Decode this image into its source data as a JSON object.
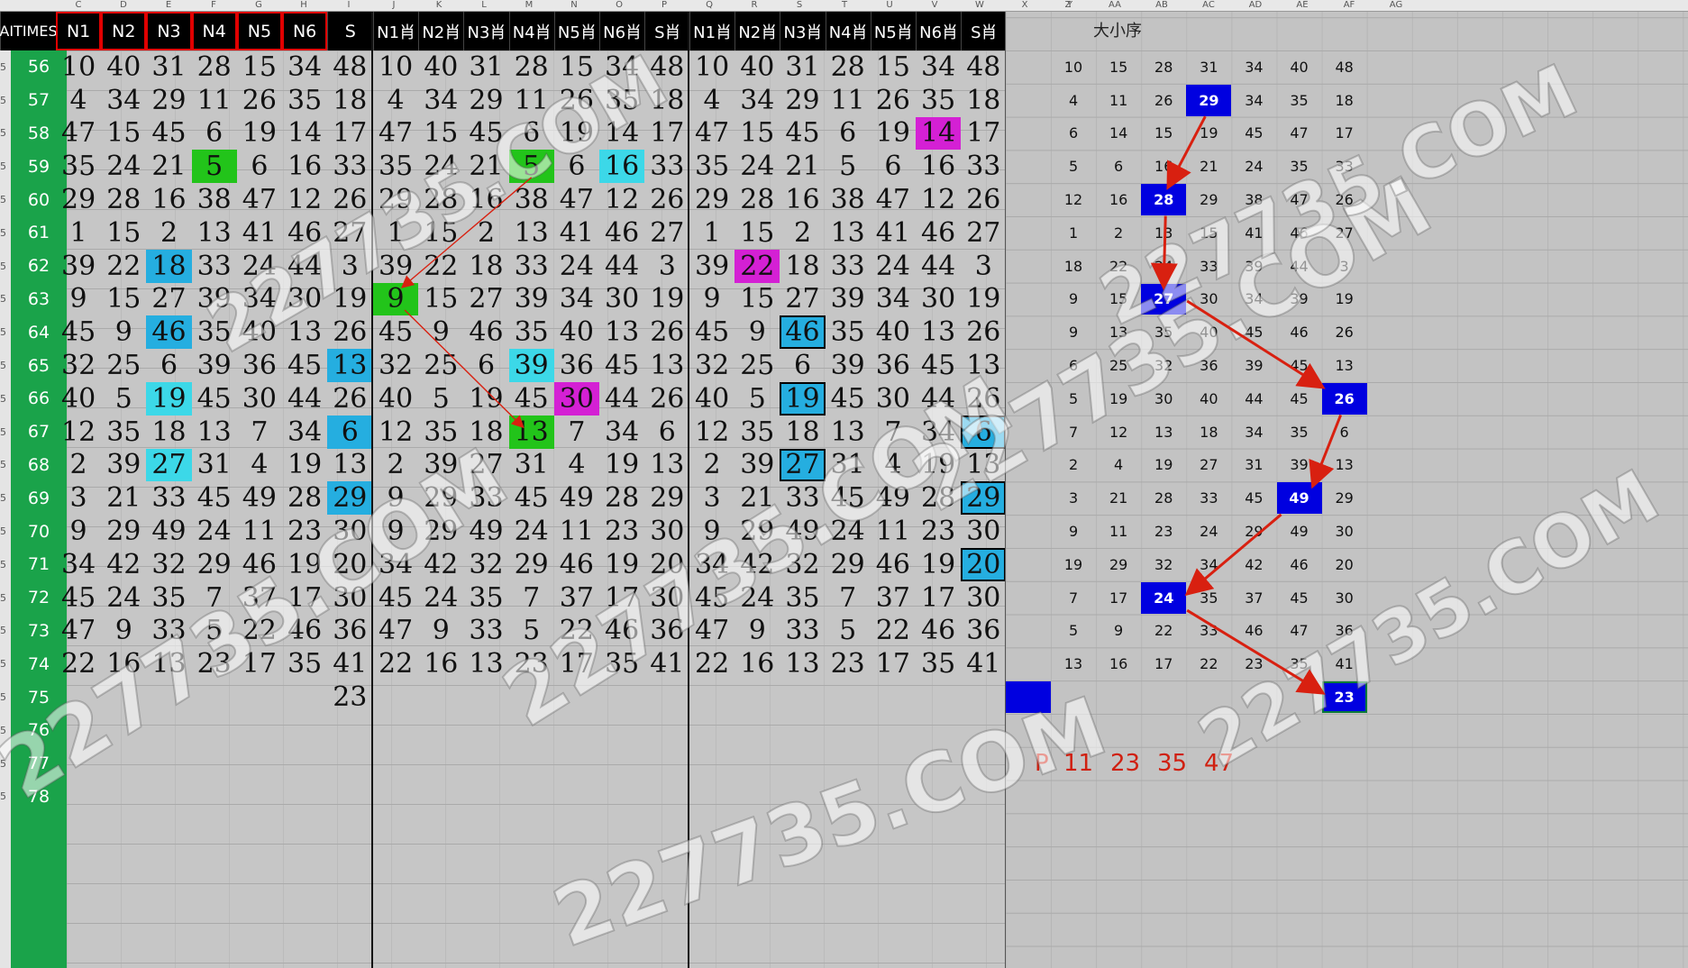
{
  "column_letters": [
    "C",
    "D",
    "E",
    "F",
    "G",
    "H",
    "I",
    "J",
    "K",
    "L",
    "M",
    "N",
    "O",
    "P",
    "Q",
    "R",
    "S",
    "T",
    "U",
    "V",
    "W",
    "X",
    "Y",
    "Z",
    "AA",
    "AB",
    "AC",
    "AD",
    "AE",
    "AF",
    "AG"
  ],
  "headers": {
    "times": "AITIMES",
    "group1": [
      "N1",
      "N2",
      "N3",
      "N4",
      "N5",
      "N6",
      "S"
    ],
    "group2": [
      "N1肖",
      "N2肖",
      "N3肖",
      "N4肖",
      "N5肖",
      "N6肖",
      "S肖"
    ],
    "group3": [
      "N1肖",
      "N2肖",
      "N3肖",
      "N4肖",
      "N5肖",
      "N6肖",
      "S肖"
    ]
  },
  "row_labels": [
    "56",
    "57",
    "58",
    "59",
    "60",
    "61",
    "62",
    "63",
    "64",
    "65",
    "66",
    "67",
    "68",
    "69",
    "70",
    "71",
    "72",
    "73",
    "74",
    "75",
    "76",
    "77",
    "78"
  ],
  "group1_rows": [
    [
      "10",
      "40",
      "31",
      "28",
      "15",
      "34",
      "48"
    ],
    [
      "4",
      "34",
      "29",
      "11",
      "26",
      "35",
      "18"
    ],
    [
      "47",
      "15",
      "45",
      "6",
      "19",
      "14",
      "17"
    ],
    [
      "35",
      "24",
      "21",
      "5",
      "6",
      "16",
      "33"
    ],
    [
      "29",
      "28",
      "16",
      "38",
      "47",
      "12",
      "26"
    ],
    [
      "1",
      "15",
      "2",
      "13",
      "41",
      "46",
      "27"
    ],
    [
      "39",
      "22",
      "18",
      "33",
      "24",
      "44",
      "3"
    ],
    [
      "9",
      "15",
      "27",
      "39",
      "34",
      "30",
      "19"
    ],
    [
      "45",
      "9",
      "46",
      "35",
      "40",
      "13",
      "26"
    ],
    [
      "32",
      "25",
      "6",
      "39",
      "36",
      "45",
      "13"
    ],
    [
      "40",
      "5",
      "19",
      "45",
      "30",
      "44",
      "26"
    ],
    [
      "12",
      "35",
      "18",
      "13",
      "7",
      "34",
      "6"
    ],
    [
      "2",
      "39",
      "27",
      "31",
      "4",
      "19",
      "13"
    ],
    [
      "3",
      "21",
      "33",
      "45",
      "49",
      "28",
      "29"
    ],
    [
      "9",
      "29",
      "49",
      "24",
      "11",
      "23",
      "30"
    ],
    [
      "34",
      "42",
      "32",
      "29",
      "46",
      "19",
      "20"
    ],
    [
      "45",
      "24",
      "35",
      "7",
      "37",
      "17",
      "30"
    ],
    [
      "47",
      "9",
      "33",
      "5",
      "22",
      "46",
      "36"
    ],
    [
      "22",
      "16",
      "13",
      "23",
      "17",
      "35",
      "41"
    ],
    [
      "",
      "",
      "",
      "",
      "",
      "",
      "23"
    ]
  ],
  "group2_rows": [
    [
      "10",
      "40",
      "31",
      "28",
      "15",
      "34",
      "48"
    ],
    [
      "4",
      "34",
      "29",
      "11",
      "26",
      "35",
      "18"
    ],
    [
      "47",
      "15",
      "45",
      "6",
      "19",
      "14",
      "17"
    ],
    [
      "35",
      "24",
      "21",
      "5",
      "6",
      "16",
      "33"
    ],
    [
      "29",
      "28",
      "16",
      "38",
      "47",
      "12",
      "26"
    ],
    [
      "1",
      "15",
      "2",
      "13",
      "41",
      "46",
      "27"
    ],
    [
      "39",
      "22",
      "18",
      "33",
      "24",
      "44",
      "3"
    ],
    [
      "9",
      "15",
      "27",
      "39",
      "34",
      "30",
      "19"
    ],
    [
      "45",
      "9",
      "46",
      "35",
      "40",
      "13",
      "26"
    ],
    [
      "32",
      "25",
      "6",
      "39",
      "36",
      "45",
      "13"
    ],
    [
      "40",
      "5",
      "19",
      "45",
      "30",
      "44",
      "26"
    ],
    [
      "12",
      "35",
      "18",
      "13",
      "7",
      "34",
      "6"
    ],
    [
      "2",
      "39",
      "27",
      "31",
      "4",
      "19",
      "13"
    ],
    [
      "9",
      "29",
      "33",
      "45",
      "49",
      "28",
      "29"
    ],
    [
      "9",
      "29",
      "49",
      "24",
      "11",
      "23",
      "30"
    ],
    [
      "34",
      "42",
      "32",
      "29",
      "46",
      "19",
      "20"
    ],
    [
      "45",
      "24",
      "35",
      "7",
      "37",
      "17",
      "30"
    ],
    [
      "47",
      "9",
      "33",
      "5",
      "22",
      "46",
      "36"
    ],
    [
      "22",
      "16",
      "13",
      "23",
      "17",
      "35",
      "41"
    ]
  ],
  "group3_rows": [
    [
      "10",
      "40",
      "31",
      "28",
      "15",
      "34",
      "48"
    ],
    [
      "4",
      "34",
      "29",
      "11",
      "26",
      "35",
      "18"
    ],
    [
      "47",
      "15",
      "45",
      "6",
      "19",
      "14",
      "17"
    ],
    [
      "35",
      "24",
      "21",
      "5",
      "6",
      "16",
      "33"
    ],
    [
      "29",
      "28",
      "16",
      "38",
      "47",
      "12",
      "26"
    ],
    [
      "1",
      "15",
      "2",
      "13",
      "41",
      "46",
      "27"
    ],
    [
      "39",
      "22",
      "18",
      "33",
      "24",
      "44",
      "3"
    ],
    [
      "9",
      "15",
      "27",
      "39",
      "34",
      "30",
      "19"
    ],
    [
      "45",
      "9",
      "46",
      "35",
      "40",
      "13",
      "26"
    ],
    [
      "32",
      "25",
      "6",
      "39",
      "36",
      "45",
      "13"
    ],
    [
      "40",
      "5",
      "19",
      "45",
      "30",
      "44",
      "26"
    ],
    [
      "12",
      "35",
      "18",
      "13",
      "7",
      "34",
      "6"
    ],
    [
      "2",
      "39",
      "27",
      "31",
      "4",
      "19",
      "13"
    ],
    [
      "3",
      "21",
      "33",
      "45",
      "49",
      "28",
      "29"
    ],
    [
      "9",
      "29",
      "49",
      "24",
      "11",
      "23",
      "30"
    ],
    [
      "34",
      "42",
      "32",
      "29",
      "46",
      "19",
      "20"
    ],
    [
      "45",
      "24",
      "35",
      "7",
      "37",
      "17",
      "30"
    ],
    [
      "47",
      "9",
      "33",
      "5",
      "22",
      "46",
      "36"
    ],
    [
      "22",
      "16",
      "13",
      "23",
      "17",
      "35",
      "41"
    ]
  ],
  "highlights": {
    "group1": [
      {
        "row": 3,
        "col": 3,
        "color": "#22c41a"
      },
      {
        "row": 6,
        "col": 2,
        "color": "#25aee0"
      },
      {
        "row": 8,
        "col": 2,
        "color": "#25aee0"
      },
      {
        "row": 9,
        "col": 6,
        "color": "#25aee0"
      },
      {
        "row": 10,
        "col": 2,
        "color": "#3cd8e8"
      },
      {
        "row": 11,
        "col": 6,
        "color": "#25aee0"
      },
      {
        "row": 12,
        "col": 2,
        "color": "#3cd8e8"
      },
      {
        "row": 13,
        "col": 6,
        "color": "#25aee0"
      }
    ],
    "group2": [
      {
        "row": 3,
        "col": 3,
        "color": "#22c41a"
      },
      {
        "row": 3,
        "col": 5,
        "color": "#3cd8e8"
      },
      {
        "row": 7,
        "col": 0,
        "color": "#22c41a"
      },
      {
        "row": 9,
        "col": 3,
        "color": "#3cd8e8"
      },
      {
        "row": 10,
        "col": 4,
        "color": "#d420d4"
      },
      {
        "row": 11,
        "col": 3,
        "color": "#22c41a"
      }
    ],
    "group3": [
      {
        "row": 2,
        "col": 5,
        "color": "#d420d4"
      },
      {
        "row": 6,
        "col": 1,
        "color": "#d420d4"
      },
      {
        "row": 8,
        "col": 2,
        "color": "#25aee0",
        "box": true
      },
      {
        "row": 10,
        "col": 2,
        "color": "#25aee0",
        "box": true
      },
      {
        "row": 11,
        "col": 6,
        "color": "#25aee0",
        "box": true
      },
      {
        "row": 12,
        "col": 2,
        "color": "#25aee0",
        "box": true
      },
      {
        "row": 13,
        "col": 6,
        "color": "#25aee0",
        "box": true
      },
      {
        "row": 15,
        "col": 6,
        "color": "#25aee0",
        "box": true
      }
    ]
  },
  "sorted_panel": {
    "title": "大小序",
    "rows": [
      [
        "10",
        "15",
        "28",
        "31",
        "34",
        "40",
        "48"
      ],
      [
        "4",
        "11",
        "26",
        "29",
        "34",
        "35",
        "18"
      ],
      [
        "6",
        "14",
        "15",
        "19",
        "45",
        "47",
        "17"
      ],
      [
        "5",
        "6",
        "16",
        "21",
        "24",
        "35",
        "33"
      ],
      [
        "12",
        "16",
        "28",
        "29",
        "38",
        "47",
        "26"
      ],
      [
        "1",
        "2",
        "13",
        "15",
        "41",
        "46",
        "27"
      ],
      [
        "18",
        "22",
        "24",
        "33",
        "39",
        "44",
        "3"
      ],
      [
        "9",
        "15",
        "27",
        "30",
        "34",
        "39",
        "19"
      ],
      [
        "9",
        "13",
        "35",
        "40",
        "45",
        "46",
        "26"
      ],
      [
        "6",
        "25",
        "32",
        "36",
        "39",
        "45",
        "13"
      ],
      [
        "5",
        "19",
        "30",
        "40",
        "44",
        "45",
        "26"
      ],
      [
        "7",
        "12",
        "13",
        "18",
        "34",
        "35",
        "6"
      ],
      [
        "2",
        "4",
        "19",
        "27",
        "31",
        "39",
        "13"
      ],
      [
        "3",
        "21",
        "28",
        "33",
        "45",
        "49",
        "29"
      ],
      [
        "9",
        "11",
        "23",
        "24",
        "29",
        "49",
        "30"
      ],
      [
        "19",
        "29",
        "32",
        "34",
        "42",
        "46",
        "20"
      ],
      [
        "7",
        "17",
        "24",
        "35",
        "37",
        "45",
        "30"
      ],
      [
        "5",
        "9",
        "22",
        "33",
        "46",
        "47",
        "36"
      ],
      [
        "13",
        "16",
        "17",
        "22",
        "23",
        "35",
        "41"
      ],
      [
        "",
        "",
        "",
        "",
        "",
        "",
        "23"
      ]
    ],
    "highlights": [
      {
        "row": 1,
        "col": 3
      },
      {
        "row": 4,
        "col": 2
      },
      {
        "row": 7,
        "col": 2
      },
      {
        "row": 10,
        "col": 6
      },
      {
        "row": 13,
        "col": 5
      },
      {
        "row": 16,
        "col": 2
      },
      {
        "row": 19,
        "col": 6,
        "selected": true
      }
    ]
  },
  "p_row": {
    "label": "P",
    "values": [
      "11",
      "23",
      "35",
      "47"
    ]
  },
  "watermark": "227735.COM",
  "colors": {
    "highlight_blue": "#0000e0",
    "arrow_red": "#d82010",
    "row_label_green": "#1aa34a"
  }
}
